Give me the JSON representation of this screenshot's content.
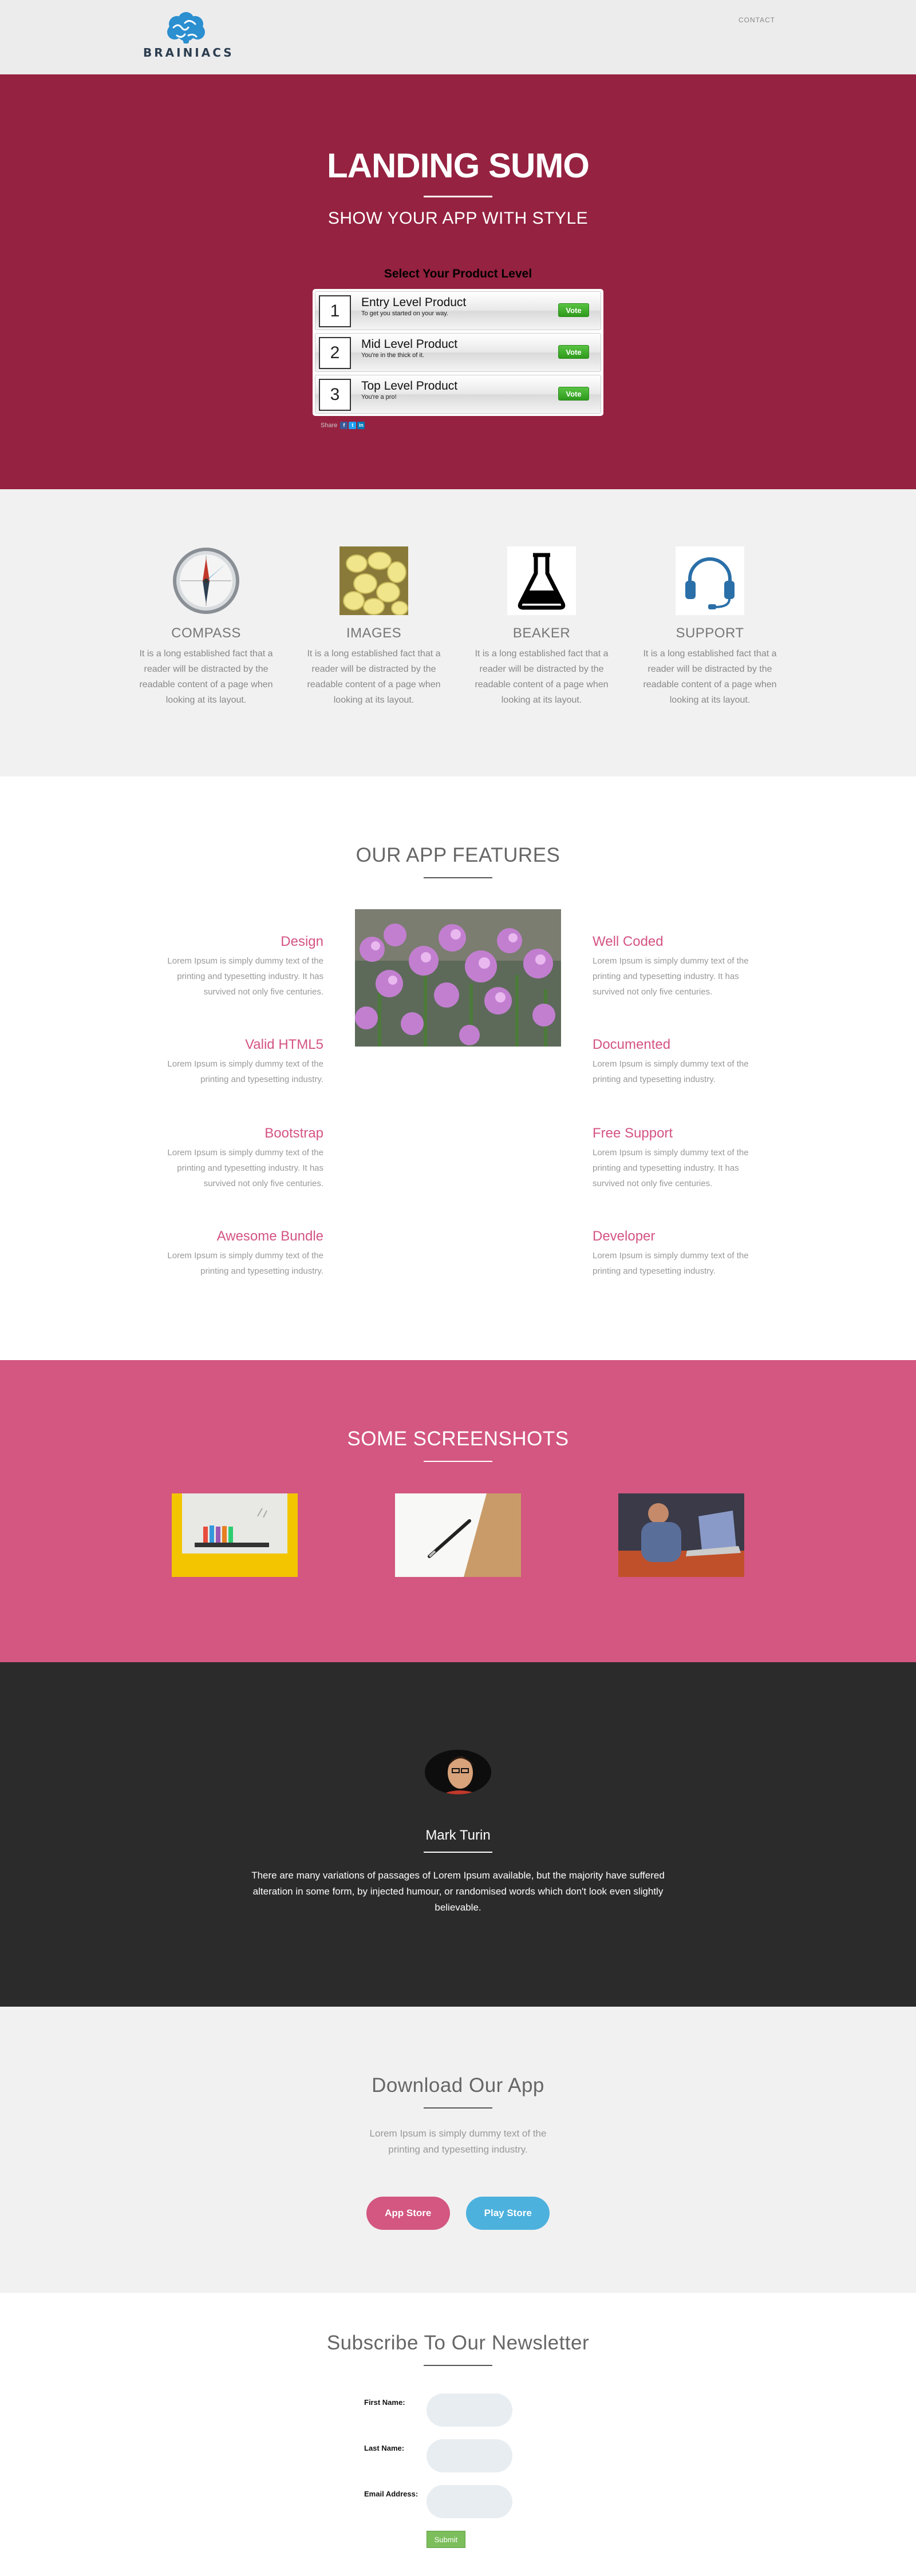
{
  "nav": {
    "logo_text": "BRAINIACS",
    "link": "CONTACT"
  },
  "hero": {
    "title": "LANDING SUMO",
    "subtitle": "SHOW YOUR APP WITH STYLE",
    "select_title": "Select Your Product Level",
    "products": [
      {
        "num": "1",
        "name": "Entry Level Product",
        "desc": "To get you started on your way.",
        "vote": "Vote"
      },
      {
        "num": "2",
        "name": "Mid Level Product",
        "desc": "You're in the thick of it.",
        "vote": "Vote"
      },
      {
        "num": "3",
        "name": "Top Level Product",
        "desc": "You're a pro!",
        "vote": "Vote"
      }
    ],
    "share_label": "Share",
    "accent_color": "#952240"
  },
  "features4": [
    {
      "title": "COMPASS",
      "text": "It is a long established fact that a reader will be distracted by the readable content of a page when looking at its layout.",
      "icon": "compass-icon"
    },
    {
      "title": "IMAGES",
      "text": "It is a long established fact that a reader will be distracted by the readable content of a page when looking at its layout.",
      "icon": "images-icon"
    },
    {
      "title": "BEAKER",
      "text": "It is a long established fact that a reader will be distracted by the readable content of a page when looking at its layout.",
      "icon": "beaker-icon"
    },
    {
      "title": "SUPPORT",
      "text": "It is a long established fact that a reader will be distracted by the readable content of a page when looking at its layout.",
      "icon": "headset-icon"
    }
  ],
  "app_features": {
    "title": "OUR APP FEATURES",
    "left": [
      {
        "title": "Design",
        "text": "Lorem Ipsum is simply dummy text of the printing and typesetting industry. It has survived not only five centuries."
      },
      {
        "title": "Valid HTML5",
        "text": "Lorem Ipsum is simply dummy text of the printing and typesetting industry."
      },
      {
        "title": "Bootstrap",
        "text": "Lorem Ipsum is simply dummy text of the printing and typesetting industry. It has survived not only five centuries."
      },
      {
        "title": "Awesome Bundle",
        "text": "Lorem Ipsum is simply dummy text of the printing and typesetting industry."
      }
    ],
    "right": [
      {
        "title": "Well Coded",
        "text": "Lorem Ipsum is simply dummy text of the printing and typesetting industry. It has survived not only five centuries."
      },
      {
        "title": "Documented",
        "text": "Lorem Ipsum is simply dummy text of the printing and typesetting industry."
      },
      {
        "title": "Free Support",
        "text": "Lorem Ipsum is simply dummy text of the printing and typesetting industry. It has survived not only five centuries."
      },
      {
        "title": "Developer",
        "text": "Lorem Ipsum is simply dummy text of the printing and typesetting industry."
      }
    ],
    "accent_color": "#d45383"
  },
  "screenshots": {
    "title": "SOME SCREENSHOTS",
    "bg_color": "#d35780"
  },
  "testimonial": {
    "name": "Mark Turin",
    "quote": "There are many variations of passages of Lorem Ipsum available, but the majority have suffered alteration in some form, by injected humour, or randomised words which don't look even slightly believable."
  },
  "download": {
    "title": "Download Our App",
    "text": "Lorem Ipsum is simply dummy text of the printing and typesetting industry.",
    "app_store": "App Store",
    "play_store": "Play Store"
  },
  "newsletter": {
    "title": "Subscribe To Our Newsletter",
    "first_name_label": "First Name:",
    "last_name_label": "Last Name:",
    "email_label": "Email Address:",
    "submit": "Submit"
  }
}
